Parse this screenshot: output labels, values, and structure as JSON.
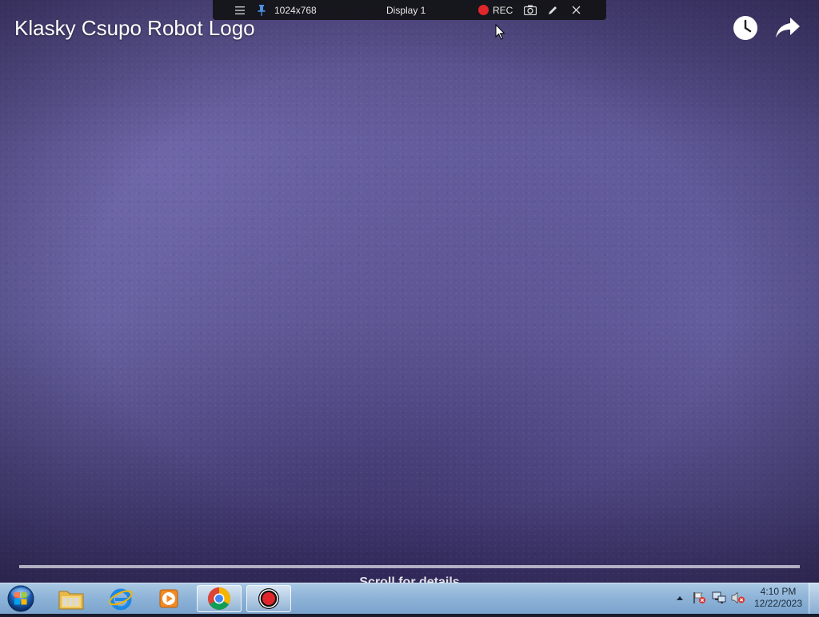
{
  "video": {
    "title": "Klasky Csupo Robot Logo",
    "scroll_hint": "Scroll for details"
  },
  "recorder_toolbar": {
    "resolution": "1024x768",
    "display": "Display 1",
    "rec_label": "REC",
    "rec_color": "#e0262b"
  },
  "icons": {
    "toolbar": [
      "menu-icon",
      "pin-icon",
      "record-icon",
      "camera-icon",
      "pen-icon",
      "close-icon"
    ],
    "video": [
      "clock-icon",
      "share-icon"
    ],
    "taskbar": [
      "start-orb-icon",
      "file-explorer-icon",
      "internet-explorer-icon",
      "media-player-icon",
      "chrome-icon",
      "recorder-icon"
    ],
    "tray": [
      "tray-expand-icon",
      "action-center-icon",
      "network-icon",
      "volume-muted-icon"
    ]
  },
  "taskbar": {
    "time": "4:10 PM",
    "date": "12/22/2023"
  }
}
